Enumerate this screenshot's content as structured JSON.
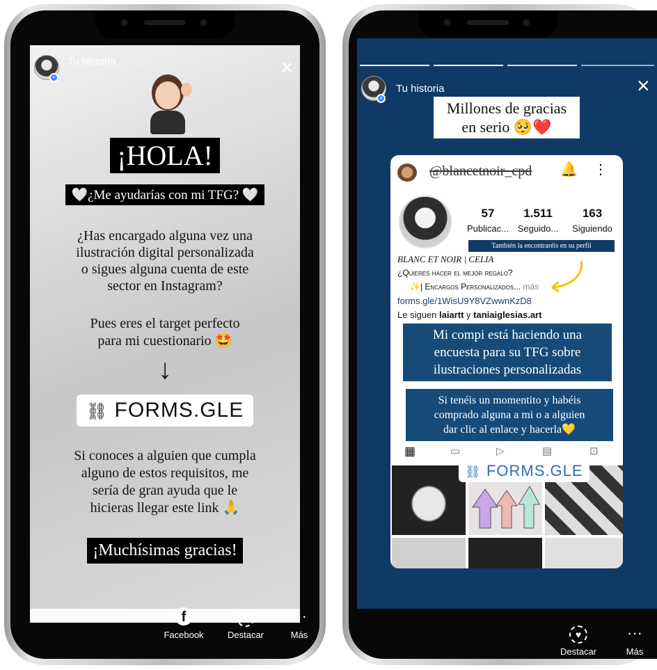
{
  "left_story": {
    "header": {
      "username": "Tu historia",
      "time": "23h"
    },
    "greeting": "¡HOLA!",
    "subtitle": "🤍¿Me ayudarías con mi TFG? 🤍",
    "paragraph1": [
      "¿Has encargado alguna vez una",
      "ilustración digital personalizada",
      "o sigues alguna cuenta de este",
      "sector en Instagram?"
    ],
    "paragraph2": [
      "Pues eres el target perfecto",
      "para mi cuestionario 🤩"
    ],
    "arrow": "↓",
    "link_sticker": "FORMS.GLE",
    "paragraph3": [
      "Si conoces a alguien que cumpla",
      "alguno de estos requisitos, me",
      "sería de gran ayuda que le",
      "hicieras llegar este link 🙏"
    ],
    "thanks": "¡Muchísimas gracias!",
    "bottom_bar": {
      "facebook": "Facebook",
      "destacar": "Destacar",
      "mas": "Más"
    }
  },
  "right_story": {
    "header": {
      "username": "Tu historia"
    },
    "title": [
      "Millones de gracias",
      "en serio 🥺❤️"
    ],
    "profile": {
      "handle": "@blancetnoir_cpd",
      "stats": [
        {
          "value": "57",
          "label": "Publicac..."
        },
        {
          "value": "1.511",
          "label": "Seguido..."
        },
        {
          "value": "163",
          "label": "Siguiendo"
        }
      ],
      "also_text": "También la encontraréis en su perfil",
      "name": "BLANC ET NOIR | CELIA",
      "bio1": "¿Quieres hacer el mejor regalo?",
      "bio2": "✨| Encargos Personalizados...",
      "bio_more": "más",
      "bio_link": "forms.gle/1WisU9Y8VZwwnKzD8",
      "followed_prefix": "Le siguen",
      "followed_a": "laiartt",
      "followed_and": "y",
      "followed_b": "taniaiglesias.art"
    },
    "overlay1": [
      "Mi compi está haciendo una",
      "encuesta para su TFG sobre",
      "ilustraciones personalizadas"
    ],
    "overlay2": [
      "Si tenéis un momentito y habéis",
      "comprado alguna a mi o a alguien",
      "dar clic al enlace y hacerla💛"
    ],
    "link_sticker": "FORMS.GLE",
    "bottom_bar": {
      "destacar": "Destacar",
      "mas": "Más"
    }
  }
}
